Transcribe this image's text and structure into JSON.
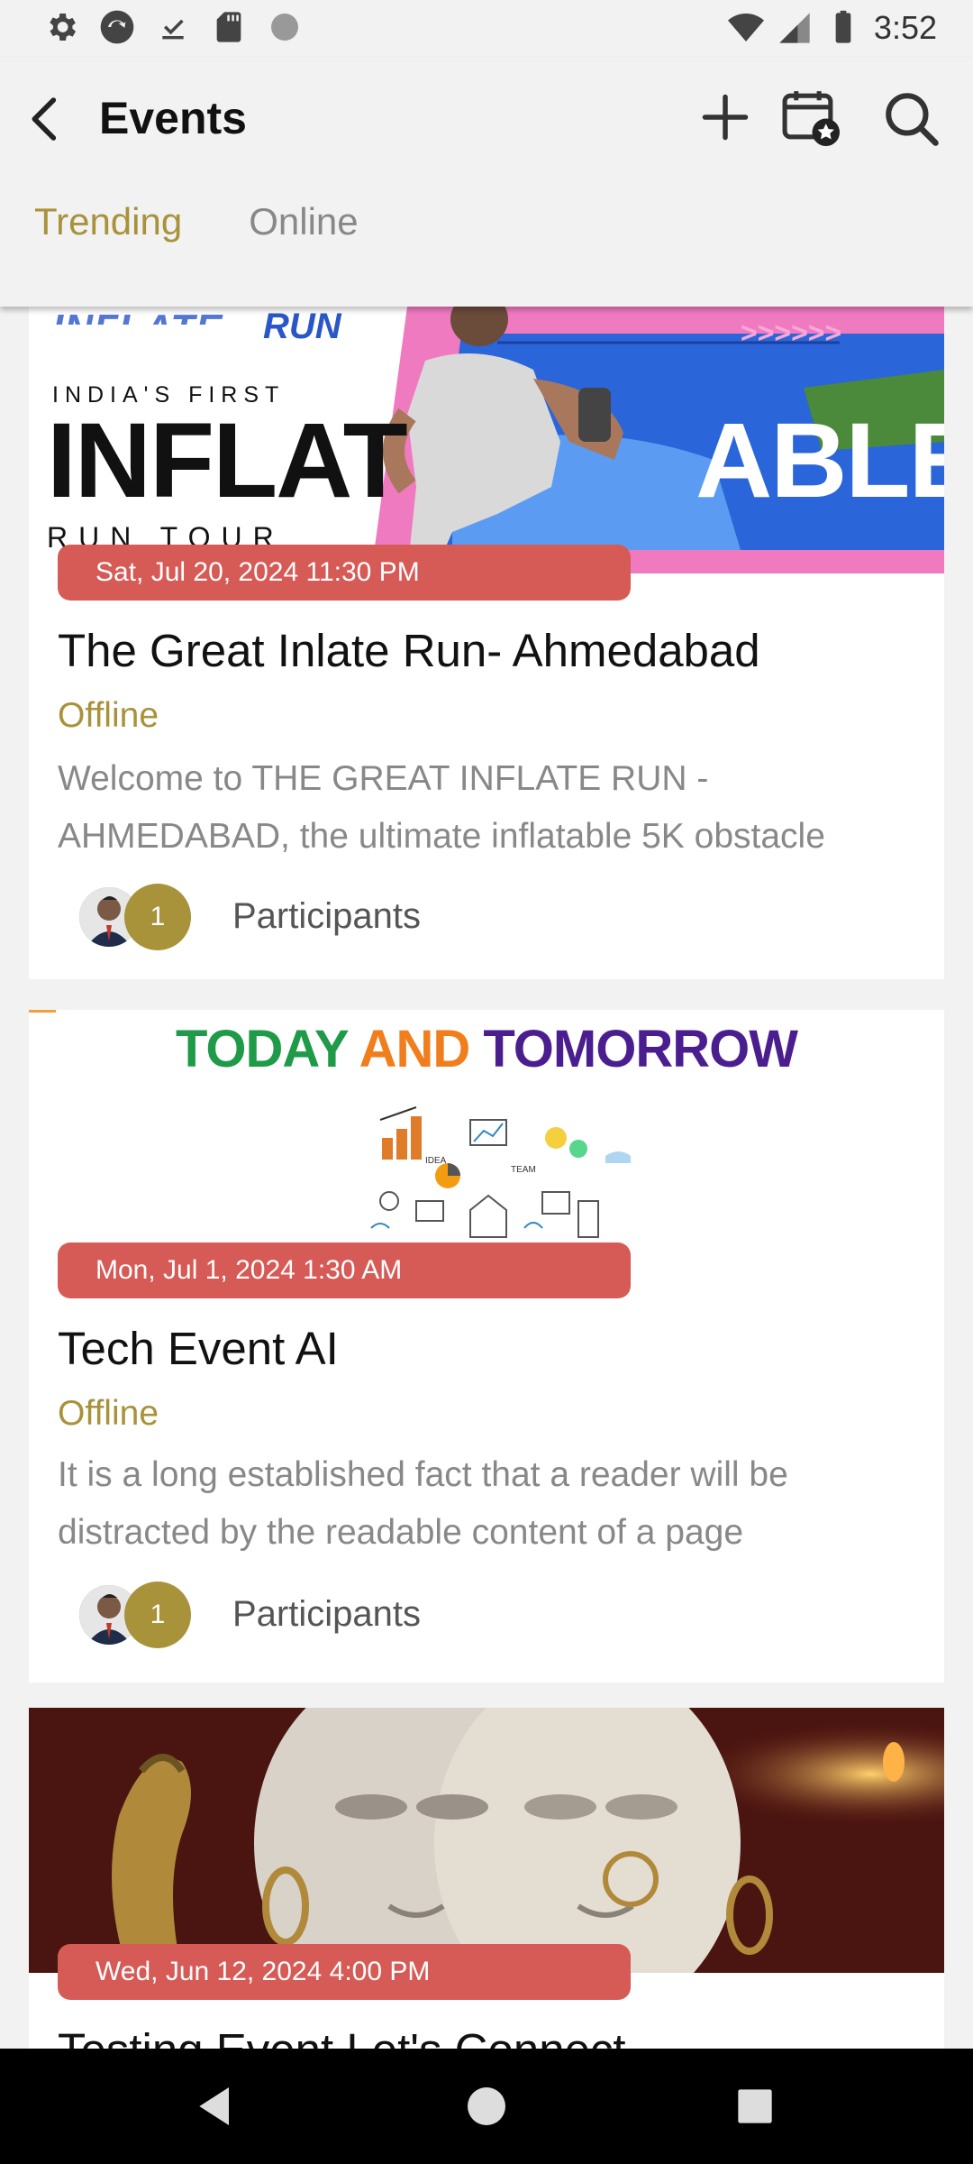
{
  "status_bar": {
    "time": "3:52",
    "icons_left": [
      "settings-icon",
      "sync-icon",
      "download-done-icon",
      "sd-card-icon",
      "circle-icon"
    ],
    "icons_right": [
      "wifi-icon",
      "signal-icon",
      "battery-icon"
    ]
  },
  "header": {
    "title": "Events",
    "actions": [
      "add-icon",
      "calendar-star-icon",
      "search-icon"
    ]
  },
  "tabs": [
    {
      "label": "Trending",
      "active": true
    },
    {
      "label": "Online",
      "active": false
    }
  ],
  "colors": {
    "accent": "#a8923a",
    "date_pill": "#d65a55",
    "background": "#f2f2f2"
  },
  "events": [
    {
      "banner": {
        "pre_heading": "INDIA'S FIRST",
        "heading_main": "INFLAT",
        "heading_tail": "ABLE",
        "sub_heading": "RUN TOUR",
        "logo_text": "RUN"
      },
      "date": "Sat, Jul 20, 2024 11:30 PM",
      "title": "The Great Inlate Run- Ahmedabad",
      "mode": "Offline",
      "description": "Welcome to THE GREAT INFLATE RUN - AHMEDABAD, the ultimate inflatable 5K obstacle",
      "participant_count": "1",
      "participants_label": "Participants"
    },
    {
      "banner": {
        "word1": "TODAY",
        "word2": "AND",
        "word3": "TOMORROW"
      },
      "date": "Mon, Jul 1, 2024 1:30 AM",
      "title": "Tech Event AI",
      "mode": "Offline",
      "description": "It is a long established fact that a reader will be distracted by the readable content of a page",
      "participant_count": "1",
      "participants_label": "Participants"
    },
    {
      "date": "Wed, Jun 12, 2024 4:00 PM",
      "title": "Testing Event Let's Connect"
    }
  ],
  "nav_bar": [
    "back-triangle-icon",
    "home-circle-icon",
    "recents-square-icon"
  ]
}
